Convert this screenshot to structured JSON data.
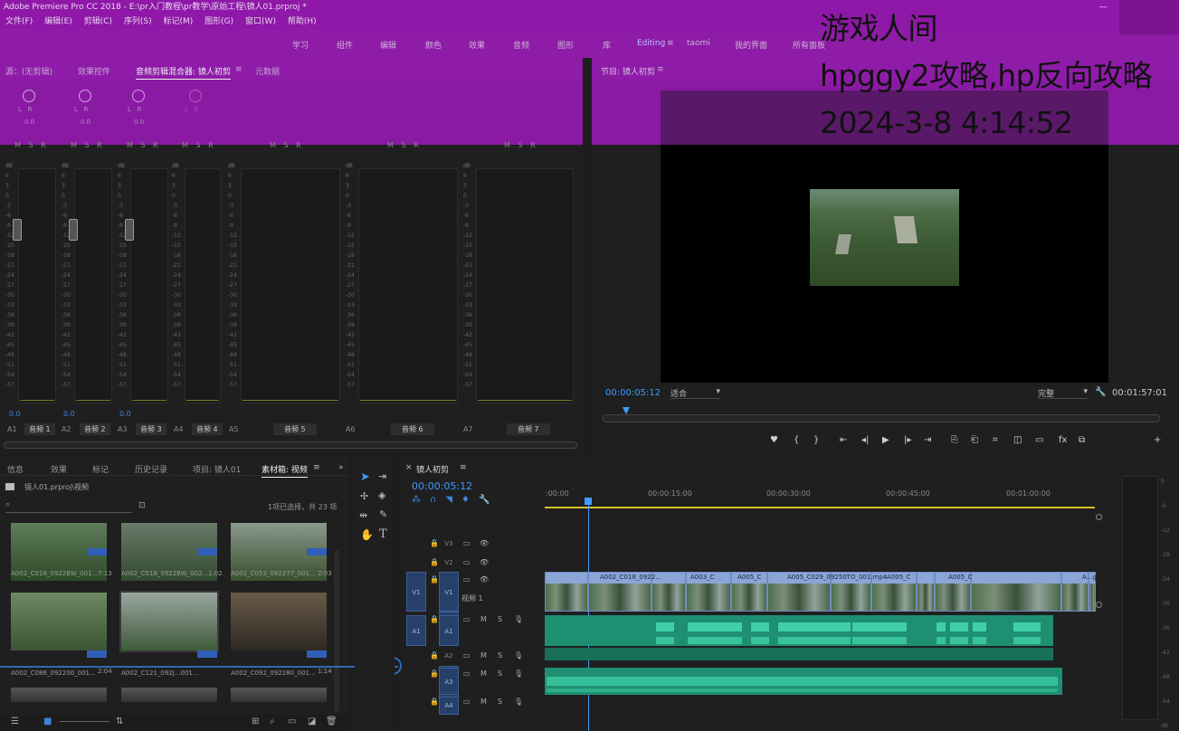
{
  "app": {
    "title": "Adobe Premiere Pro CC 2018 - E:\\pr入门教程\\pr教学\\原始工程\\镜人01.prproj *",
    "window_controls": "— ❐ ✕"
  },
  "menu": [
    "文件(F)",
    "编辑(E)",
    "剪辑(C)",
    "序列(S)",
    "标记(M)",
    "图形(G)",
    "窗口(W)",
    "帮助(H)"
  ],
  "workspaces": [
    "学习",
    "组件",
    "编辑",
    "颜色",
    "效果",
    "音频",
    "图形",
    "库",
    "Editing",
    "taomi",
    "我的界面",
    "所有面板"
  ],
  "watermark": {
    "line1": "游戏人间",
    "line2": "hpggy2攻略,hp反向攻略",
    "line3": "2024-3-8 4:14:52"
  },
  "left_panel_tabs": [
    "源：(无剪辑)",
    "效果控件",
    "音频剪辑混合器: 镜人初剪",
    "元数据"
  ],
  "program_tab": "节目: 镜人初剪",
  "mixer": {
    "knob_label": "L",
    "knob_label_r": "R",
    "knob_value": "0.0",
    "msr": "M S R",
    "db_label": "dB",
    "scale": [
      "6",
      "3",
      "0",
      "-3",
      "-6",
      "-9",
      "-12",
      "-15",
      "-18",
      "-21",
      "-24",
      "-27",
      "-30",
      "-33",
      "-36",
      "-39",
      "-42",
      "-45",
      "-48",
      "-51",
      "-54",
      "-57",
      "dB"
    ],
    "volume": "0.0",
    "channels": [
      {
        "id": "A1",
        "name": "音频 1"
      },
      {
        "id": "A2",
        "name": "音频 2"
      },
      {
        "id": "A3",
        "name": "音频 3"
      },
      {
        "id": "A4",
        "name": "音频 4"
      },
      {
        "id": "A5",
        "name": "音频 5"
      },
      {
        "id": "A6",
        "name": "音频 6"
      },
      {
        "id": "A7",
        "name": "音频 7"
      }
    ]
  },
  "program": {
    "timecode_current": "00:00:05:12",
    "fit": "适合",
    "quality": "完整",
    "timecode_duration": "00:01:57:01",
    "controls": [
      "♥",
      "{",
      "}",
      "⇤",
      "◂|",
      "▶",
      "|▸",
      "⇥",
      "⎘",
      "⎗",
      "⌗",
      "◫",
      "▭",
      "fx",
      "⧉",
      "+"
    ]
  },
  "project": {
    "tabs": [
      "信息",
      "效果",
      "标记",
      "历史记录",
      "项目: 镜人01",
      "素材箱: 视频"
    ],
    "path": "镜人01.prproj\\视频",
    "selection": "1项已选择，共 23 项",
    "items": [
      {
        "name": "A002_C018_0922BW_001...",
        "dur": "7:13"
      },
      {
        "name": "A002_C018_0922BW_002...",
        "dur": "1:02"
      },
      {
        "name": "A002_C053_092277_001...",
        "dur": "2:03"
      },
      {
        "name": "A002_C086_092200_001...",
        "dur": "2:04"
      },
      {
        "name": "A002_C121_092J...001...",
        "dur": ""
      },
      {
        "name": "A002_C092_092280_001...",
        "dur": "1:14"
      }
    ]
  },
  "timeline": {
    "tab": "镜人初剪",
    "timecode": "00:00:05:12",
    "ruler": [
      ":00:00",
      "00:00:15:00",
      "00:00:30:00",
      "00:00:45:00",
      "00:01:00:00"
    ],
    "video_tracks": [
      "V3",
      "V2",
      "V1"
    ],
    "audio_tracks": [
      "A1",
      "A2",
      "A3",
      "A4"
    ],
    "v1_source": "V1",
    "a1_source": "A1",
    "v1_label": "视频 1",
    "clips": [
      "A002_C018_0922...",
      "A003_C",
      "A005_C",
      "A005_C029_09250TO_001.mp4",
      "A005_C",
      "A005_C",
      "A...g"
    ],
    "track_m": "M",
    "track_s": "S"
  },
  "right_meter": {
    "scale": [
      "0",
      "-6",
      "-12",
      "-18",
      "-24",
      "-30",
      "-36",
      "-42",
      "-48",
      "-54",
      "dB"
    ]
  }
}
